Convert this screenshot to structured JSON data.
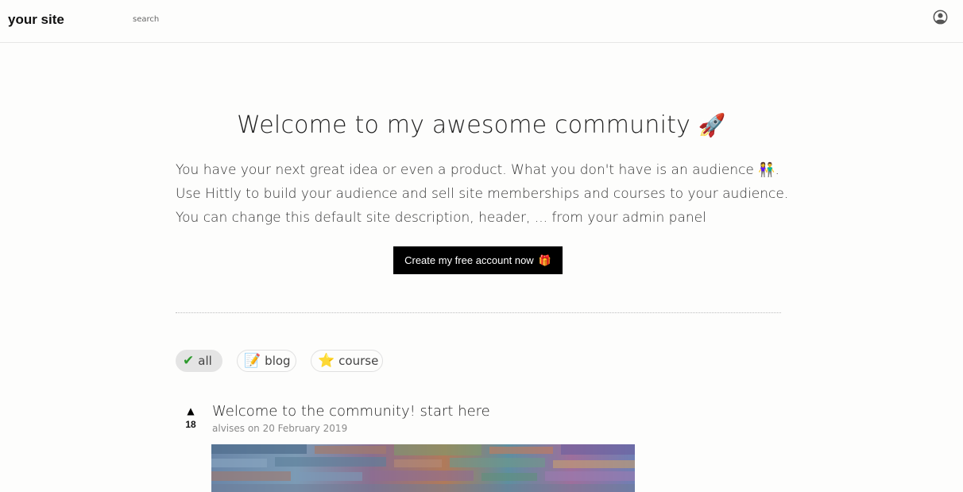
{
  "header": {
    "site_name": "your site",
    "search_placeholder": "search",
    "user_icon": "user-circle-icon"
  },
  "hero": {
    "title": "Welcome to my awesome community",
    "title_emoji": "🚀",
    "description_lines": [
      "You have your next great idea or even a product. What you don't have is an audience",
      "Use Hittly to build your audience and sell site memberships and courses to your audience.",
      "You can change this default site description, header, ... from your admin panel"
    ],
    "audience_emoji": "👫",
    "line1_end": ".",
    "cta_label": "Create my free account now",
    "cta_emoji": "🎁"
  },
  "filters": [
    {
      "label": "all",
      "icon": "check-mark-icon",
      "glyph": "✔",
      "active": true
    },
    {
      "label": "blog",
      "icon": "memo-icon",
      "glyph": "📝",
      "active": false
    },
    {
      "label": "course",
      "icon": "star-icon",
      "glyph": "⭐",
      "active": false
    }
  ],
  "posts": [
    {
      "title": "Welcome to the community! start here",
      "meta": "alvises on 20 February 2019",
      "votes": "18",
      "vote_icon": "upvote-arrow-icon"
    }
  ],
  "colors": {
    "background": "#fdfdfc",
    "cta_background": "#000000",
    "chip_active": "#e4e4e4",
    "check_green": "#2e9b2e"
  }
}
